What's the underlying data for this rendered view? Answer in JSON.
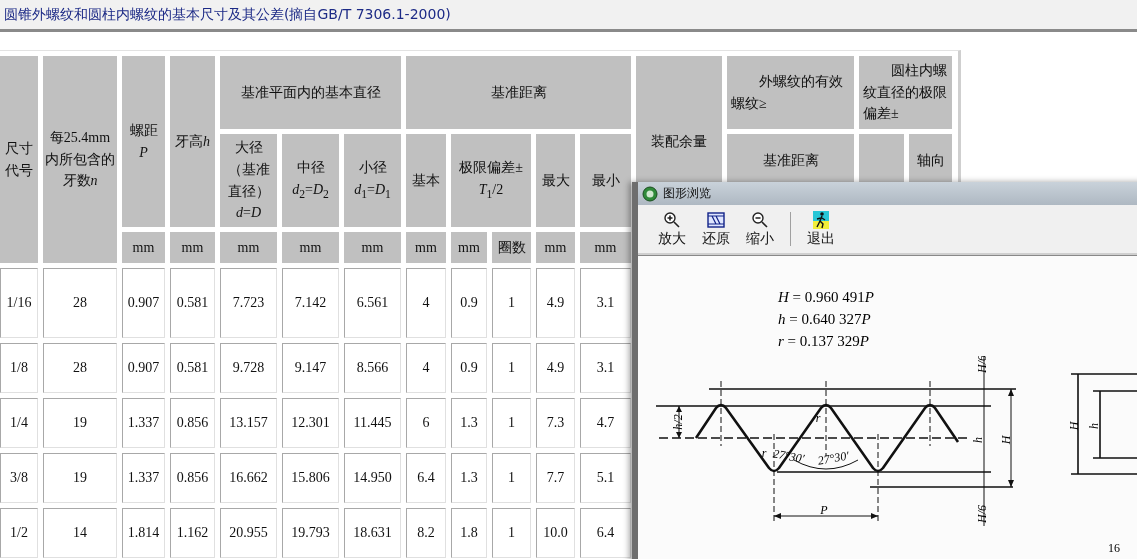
{
  "page_title": "圆锥外螺纹和圆柱内螺纹的基本尺寸及其公差(摘自GB/T 7306.1-2000)",
  "table": {
    "header_cells": [
      {
        "text": "尺寸代号"
      },
      {
        "text": "每25.4mm内所包含的牙数",
        "symbol": "n"
      },
      {
        "text": "螺距",
        "formula": "*P*"
      },
      {
        "text": "牙高",
        "symbol": "h"
      },
      {
        "text": "基准平面内的基本直径"
      },
      {
        "text": "基准距离"
      },
      {
        "text": "装配余量"
      },
      {
        "text": "外螺纹的有效螺纹≥"
      },
      {
        "text": "圆柱内螺纹直径的极限偏差±"
      },
      {
        "text": "大径（基准直径）",
        "formula": "*d*=*D*"
      },
      {
        "text": "中径",
        "formula": "*d*$_{2}$=*D*$_{2}$"
      },
      {
        "text": "小径",
        "formula": "*d*$_{1}$=*D*$_{1}$"
      },
      {
        "text": "基本"
      },
      {
        "text": "极限偏差±",
        "formula": "*T*$_{1}$/2"
      },
      {
        "text": "最大"
      },
      {
        "text": "最小"
      },
      {
        "text": "基准距离"
      },
      {
        "text": "轴向"
      }
    ],
    "units": [
      "mm",
      "mm",
      "mm",
      "mm",
      "mm",
      "mm",
      "mm",
      "圈数",
      "mm",
      "mm"
    ],
    "rows": [
      [
        "1/16",
        "28",
        "0.907",
        "0.581",
        "7.723",
        "7.142",
        "6.561",
        "4",
        "0.9",
        "1",
        "4.9",
        "3.1"
      ],
      [
        "1/8",
        "28",
        "0.907",
        "0.581",
        "9.728",
        "9.147",
        "8.566",
        "4",
        "0.9",
        "1",
        "4.9",
        "3.1"
      ],
      [
        "1/4",
        "19",
        "1.337",
        "0.856",
        "13.157",
        "12.301",
        "11.445",
        "6",
        "1.3",
        "1",
        "7.3",
        "4.7"
      ],
      [
        "3/8",
        "19",
        "1.337",
        "0.856",
        "16.662",
        "15.806",
        "14.950",
        "6.4",
        "1.3",
        "1",
        "7.7",
        "5.1"
      ],
      [
        "1/2",
        "14",
        "1.814",
        "1.162",
        "20.955",
        "19.793",
        "18.631",
        "8.2",
        "1.8",
        "1",
        "10.0",
        "6.4"
      ]
    ]
  },
  "viewer": {
    "title": "图形浏览",
    "toolbar": [
      {
        "label": "放大",
        "kind": "zoom-in"
      },
      {
        "label": "还原",
        "kind": "restore"
      },
      {
        "label": "缩小",
        "kind": "zoom-out"
      },
      {
        "label": "退出",
        "kind": "exit"
      }
    ],
    "formulas": [
      {
        "text": "*H* = 0.960 491",
        "symbol": "P"
      },
      {
        "text": "*h* = 0.640 327",
        "symbol": "P"
      },
      {
        "text": "*r* = 0.137 329",
        "symbol": "P"
      }
    ],
    "drawing_labels": [
      "h/2",
      "H/6",
      "h",
      "H",
      "r",
      "r",
      "27°30′",
      "27°30′",
      "P",
      "H/6",
      "H",
      "h"
    ],
    "page_number": "16"
  }
}
